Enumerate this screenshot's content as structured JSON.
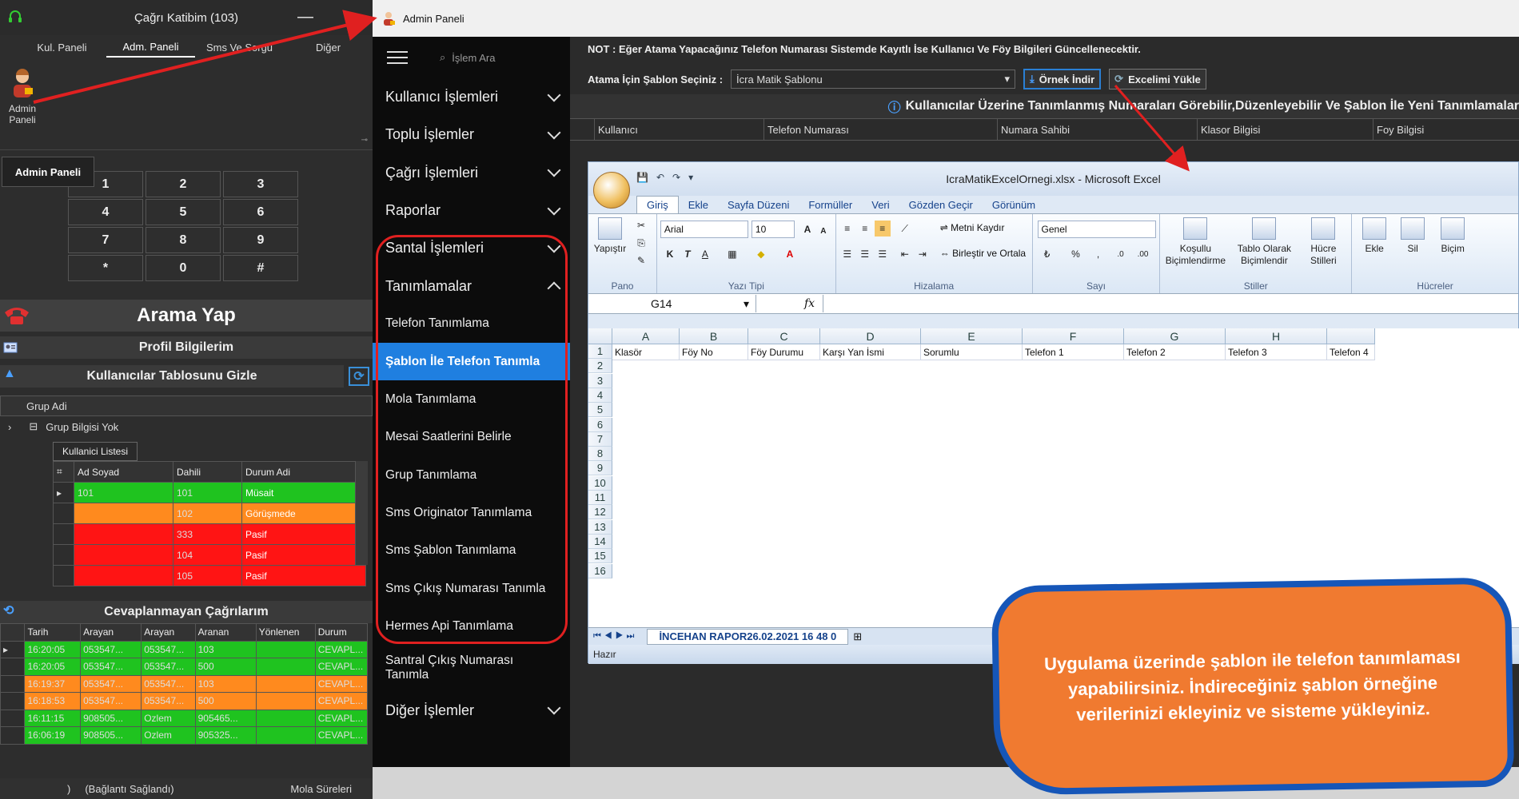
{
  "left_app": {
    "title": "Çağrı Katibim (103)",
    "minimize": "—",
    "close": "✕",
    "menu": [
      "Kul. Paneli",
      "Adm. Paneli",
      "Sms Ve Sorgu",
      "Diğer"
    ],
    "admin_icon_label_1": "Admin",
    "admin_icon_label_2": "Paneli",
    "tooltip": "Admin Paneli",
    "dialpad": [
      "1",
      "2",
      "3",
      "4",
      "5",
      "6",
      "7",
      "8",
      "9",
      "*",
      "0",
      "#"
    ],
    "call_button": "Arama Yap",
    "profile": "Profil Bilgilerim",
    "hide_users": "Kullanıcılar Tablosunu Gizle",
    "group_header": "Grup Adi",
    "group_row": "Grup Bilgisi Yok",
    "user_list_tab": "Kullanici Listesi",
    "user_columns": [
      "Ad Soyad",
      "Dahili",
      "Durum Adi"
    ],
    "users": [
      {
        "name": "101",
        "ext": "101",
        "status": "Müsait",
        "color": "g"
      },
      {
        "name": "",
        "ext": "102",
        "status": "Görüşmede",
        "color": "o"
      },
      {
        "name": "",
        "ext": "333",
        "status": "Pasif",
        "color": "r"
      },
      {
        "name": "",
        "ext": "104",
        "status": "Pasif",
        "color": "r"
      },
      {
        "name": "",
        "ext": "105",
        "status": "Pasif",
        "color": "r"
      }
    ],
    "missed_calls_title": "Cevaplanmayan Çağrılarım",
    "call_columns": [
      "Tarih",
      "Arayan",
      "Arayan",
      "Aranan",
      "Yönlenen",
      "Durum"
    ],
    "calls": [
      {
        "time": "16:20:05",
        "caller": "053547...",
        "caller2": "053547...",
        "callee": "103",
        "fwd": "",
        "status": "CEVAPL...",
        "color": "g"
      },
      {
        "time": "16:20:05",
        "caller": "053547...",
        "caller2": "053547...",
        "callee": "500",
        "fwd": "",
        "status": "CEVAPL...",
        "color": "g"
      },
      {
        "time": "16:19:37",
        "caller": "053547...",
        "caller2": "053547...",
        "callee": "103",
        "fwd": "",
        "status": "CEVAPL...",
        "color": "o"
      },
      {
        "time": "16:18:53",
        "caller": "053547...",
        "caller2": "053547...",
        "callee": "500",
        "fwd": "",
        "status": "CEVAPL...",
        "color": "o"
      },
      {
        "time": "16:11:15",
        "caller": "908505...",
        "caller2": "Ozlem",
        "callee": "905465...",
        "fwd": "",
        "status": "CEVAPL...",
        "color": "g"
      },
      {
        "time": "16:06:19",
        "caller": "908505...",
        "caller2": "Ozlem",
        "callee": "905325...",
        "fwd": "",
        "status": "CEVAPL...",
        "color": "g"
      }
    ],
    "status_left": ")",
    "status_mid": "(Bağlantı Sağlandı)",
    "status_right": "Mola Süreleri"
  },
  "admin": {
    "title": "Admin Paneli",
    "search_placeholder": "İşlem Ara",
    "nav": [
      {
        "label": "Kullanıcı İşlemleri",
        "type": "group"
      },
      {
        "label": "Toplu İşlemler",
        "type": "group"
      },
      {
        "label": "Çağrı İşlemleri",
        "type": "group"
      },
      {
        "label": "Raporlar",
        "type": "group"
      },
      {
        "label": "Santal İşlemleri",
        "type": "group"
      },
      {
        "label": "Tanımlamalar",
        "type": "open"
      },
      {
        "label": "Telefon Tanımlama",
        "type": "sub"
      },
      {
        "label": "Şablon İle Telefon Tanımla",
        "type": "sel"
      },
      {
        "label": "Mola Tanımlama",
        "type": "sub"
      },
      {
        "label": "Mesai Saatlerini Belirle",
        "type": "sub"
      },
      {
        "label": "Grup Tanımlama",
        "type": "sub"
      },
      {
        "label": "Sms Originator Tanımlama",
        "type": "sub"
      },
      {
        "label": "Sms Şablon Tanımlama",
        "type": "sub"
      },
      {
        "label": "Sms Çıkış Numarası Tanımla",
        "type": "sub"
      },
      {
        "label": "Hermes Api Tanımlama",
        "type": "sub"
      },
      {
        "label": "Santral Çıkış Numarası Tanımla",
        "type": "sub2"
      },
      {
        "label": "Diğer İşlemler",
        "type": "group"
      }
    ],
    "note": "NOT : Eğer Atama Yapacağınız Telefon Numarası Sistemde Kayıtlı İse Kullanıcı Ve Föy Bilgileri Güncellenecektir.",
    "template_label": "Atama İçin Şablon Seçiniz :",
    "template_value": "İcra Matik Şablonu",
    "download_btn": "Örnek İndir",
    "upload_btn": "Excelimi Yükle",
    "info": "Kullanıcılar Üzerine Tanımlanmış Numaraları Görebilir,Düzenleyebilir Ve Şablon İle Yeni Tanımlamalar",
    "columns": [
      "Kullanıcı",
      "Telefon Numarası",
      "Numara Sahibi",
      "Klasor Bilgisi",
      "Foy Bilgisi"
    ]
  },
  "excel": {
    "title": "IcraMatikExcelOrnegi.xlsx - Microsoft Excel",
    "tabs": [
      "Giriş",
      "Ekle",
      "Sayfa Düzeni",
      "Formüller",
      "Veri",
      "Gözden Geçir",
      "Görünüm"
    ],
    "font": "Arial",
    "font_size": "10",
    "wrap": "Metni Kaydır",
    "merge": "Birleştir ve Ortala",
    "number_format": "Genel",
    "paste": "Yapıştır",
    "groups": [
      "Pano",
      "Yazı Tipi",
      "Hizalama",
      "Sayı",
      "Stiller",
      "Hücreler"
    ],
    "styles": [
      "Koşullu Biçimlendirme",
      "Tablo Olarak Biçimlendir",
      "Hücre Stilleri"
    ],
    "cells_btns": [
      "Ekle",
      "Sil",
      "Biçim"
    ],
    "name_box": "G14",
    "fx": "fx",
    "col_letters": [
      "A",
      "B",
      "C",
      "D",
      "E",
      "F",
      "G",
      "H"
    ],
    "row_numbers": [
      "1",
      "2",
      "3",
      "4",
      "5",
      "6",
      "7",
      "8",
      "9",
      "10",
      "11",
      "12",
      "13",
      "14",
      "15",
      "16"
    ],
    "row1": [
      "Klasör",
      "Föy No",
      "Föy Durumu",
      "Karşı Yan İsmi",
      "Sorumlu",
      "Telefon 1",
      "Telefon 2",
      "Telefon 3",
      "Telefon 4"
    ],
    "sheet_tab": "İNCEHAN RAPOR26.02.2021 16 48 0",
    "status": "Hazır"
  },
  "callout": "Uygulama üzerinde şablon ile telefon tanımlaması yapabilirsiniz. İndireceğiniz şablon örneğine verilerinizi ekleyiniz ve sisteme yükleyiniz.",
  "colors": {
    "accent_blue": "#1f7fe0",
    "arrow_red": "#e02020",
    "callout_orange": "#f07a30",
    "callout_border": "#1656b8"
  }
}
